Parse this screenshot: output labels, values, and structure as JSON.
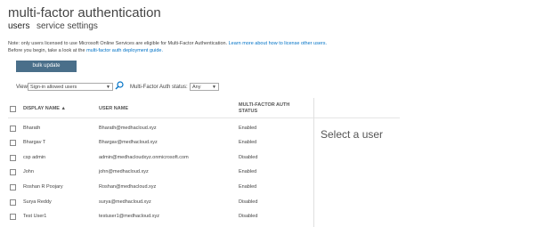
{
  "page": {
    "title": "multi-factor authentication",
    "tabs": [
      {
        "label": "users",
        "active": true
      },
      {
        "label": "service settings",
        "active": false
      }
    ]
  },
  "notes": {
    "line1_prefix": "Note: only users licensed to use Microsoft Online Services are eligible for Multi-Factor Authentication.",
    "line1_link": "Learn more about how to license other users.",
    "line2_prefix": "Before you begin, take a look at the",
    "line2_link": "multi-factor auth deployment guide."
  },
  "toolbar": {
    "bulk_update_label": "bulk update",
    "view_label": "View:",
    "view_value": "Sign-in allowed users",
    "mfa_status_label": "Multi-Factor Auth status:",
    "mfa_status_value": "Any"
  },
  "table": {
    "columns": {
      "display_name": "DISPLAY NAME",
      "sort_indicator": "▲",
      "user_name": "USER NAME",
      "mfa_status_line1": "MULTI-FACTOR AUTH",
      "mfa_status_line2": "STATUS"
    },
    "rows": [
      {
        "display_name": "Bharath",
        "user_name": "Bharath@medhacloud.xyz",
        "status": "Enabled"
      },
      {
        "display_name": "Bhargav T",
        "user_name": "Bhargav@medhacloud.xyz",
        "status": "Enabled"
      },
      {
        "display_name": "csp admin",
        "user_name": "admin@medhacloudxyz.onmicrosoft.com",
        "status": "Disabled"
      },
      {
        "display_name": "John",
        "user_name": "john@medhacloud.xyz",
        "status": "Enabled"
      },
      {
        "display_name": "Roshan R Poojary",
        "user_name": "Roshan@medhacloud.xyz",
        "status": "Enabled"
      },
      {
        "display_name": "Surya Reddy",
        "user_name": "surya@medhacloud.xyz",
        "status": "Disabled"
      },
      {
        "display_name": "Test User1",
        "user_name": "testuser1@medhacloud.xyz",
        "status": "Disabled"
      }
    ]
  },
  "detail_panel": {
    "placeholder": "Select a user"
  },
  "colors": {
    "accent_button": "#4a6f8a",
    "link": "#0072c6"
  },
  "icons": {
    "search": "search-icon",
    "dropdown": "chevron-down-icon",
    "checkbox": "checkbox"
  }
}
